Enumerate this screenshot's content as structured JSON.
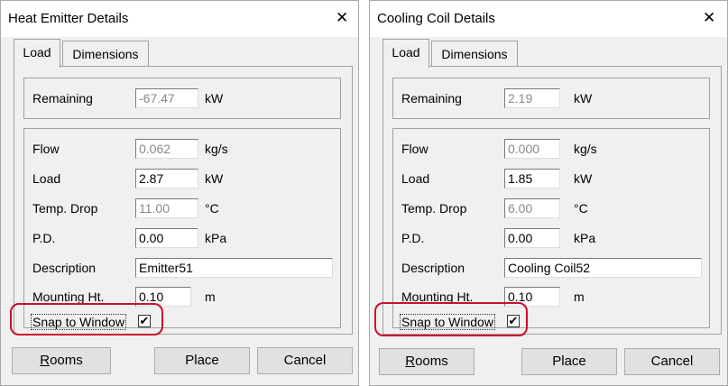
{
  "dialogs": [
    {
      "title": "Heat Emitter Details",
      "close_glyph": "✕",
      "tabs": [
        "Load",
        "Dimensions"
      ],
      "remaining": {
        "label": "Remaining",
        "value": "-67.47",
        "unit": "kW"
      },
      "fields": {
        "flow": {
          "label": "Flow",
          "value": "0.062",
          "unit": "kg/s"
        },
        "load": {
          "label": "Load",
          "value": "2.87",
          "unit": "kW"
        },
        "temp_drop": {
          "label": "Temp. Drop",
          "value": "11.00",
          "unit": "°C"
        },
        "pd": {
          "label": "P.D.",
          "value": "0.00",
          "unit": "kPa"
        },
        "description": {
          "label": "Description",
          "value": "Emitter51"
        },
        "mounting": {
          "label": "Mounting Ht.",
          "value": "0.10",
          "unit": "m"
        }
      },
      "snap": {
        "label": "Snap to Window",
        "checked_glyph": "✔"
      },
      "buttons": {
        "rooms_first": "R",
        "rooms_rest": "ooms",
        "place": "Place",
        "cancel": "Cancel"
      }
    },
    {
      "title": "Cooling Coil Details",
      "close_glyph": "✕",
      "tabs": [
        "Load",
        "Dimensions"
      ],
      "remaining": {
        "label": "Remaining",
        "value": "2.19",
        "unit": "kW"
      },
      "fields": {
        "flow": {
          "label": "Flow",
          "value": "0.000",
          "unit": "kg/s"
        },
        "load": {
          "label": "Load",
          "value": "1.85",
          "unit": "kW"
        },
        "temp_drop": {
          "label": "Temp. Drop",
          "value": "6.00",
          "unit": "°C"
        },
        "pd": {
          "label": "P.D.",
          "value": "0.00",
          "unit": "kPa"
        },
        "description": {
          "label": "Description",
          "value": "Cooling Coil52"
        },
        "mounting": {
          "label": "Mounting Ht.",
          "value": "0.10",
          "unit": "m"
        }
      },
      "snap": {
        "label": "Snap to Window",
        "checked_glyph": "✔"
      },
      "buttons": {
        "rooms_first": "R",
        "rooms_rest": "ooms",
        "place": "Place",
        "cancel": "Cancel"
      }
    }
  ],
  "colors": {
    "highlight": "#c8102e",
    "dialog_bg": "#f0f0f0",
    "disabled_text": "#8a8a8a"
  }
}
